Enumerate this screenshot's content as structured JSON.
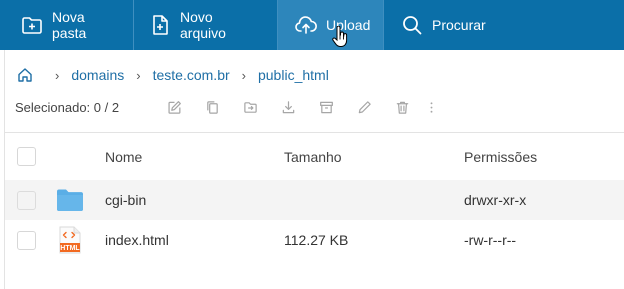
{
  "toolbar": {
    "new_folder": "Nova pasta",
    "new_file": "Novo arquivo",
    "upload": "Upload",
    "search": "Procurar"
  },
  "breadcrumb": [
    "domains",
    "teste.com.br",
    "public_html"
  ],
  "selection": {
    "label": "Selecionado: 0 / 2"
  },
  "columns": {
    "name": "Nome",
    "size": "Tamanho",
    "permissions": "Permissões"
  },
  "files": [
    {
      "name": "cgi-bin",
      "type": "folder",
      "size": "",
      "permissions": "drwxr-xr-x"
    },
    {
      "name": "index.html",
      "type": "html",
      "size": "112.27 KB",
      "permissions": "-rw-r--r--"
    }
  ],
  "icons": {
    "new_folder": "folder-plus-icon",
    "new_file": "file-plus-icon",
    "upload": "cloud-upload-icon",
    "search": "search-icon",
    "home": "home-icon",
    "actions": [
      "edit-icon",
      "copy-icon",
      "move-icon",
      "download-icon",
      "archive-icon",
      "rename-icon",
      "delete-icon",
      "more-icon"
    ],
    "html_badge": "HTML"
  },
  "colors": {
    "toolbar": "#0b6fa8",
    "toolbar_active": "#2d86bb",
    "link": "#1f6fa6",
    "folder": "#5aaee6",
    "html_file": "#f26a21"
  }
}
